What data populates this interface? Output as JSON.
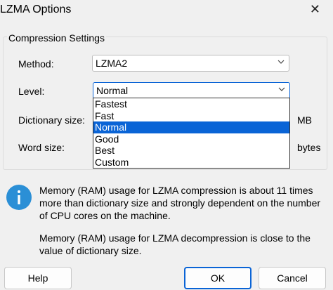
{
  "window": {
    "title": "LZMA Options",
    "close_glyph": "✕"
  },
  "group": {
    "label": "Compression Settings"
  },
  "fields": {
    "method": {
      "label": "Method:",
      "value": "LZMA2"
    },
    "level": {
      "label": "Level:",
      "value": "Normal"
    },
    "dictionary": {
      "label": "Dictionary size:",
      "unit": "MB"
    },
    "word": {
      "label": "Word size:",
      "unit": "bytes"
    }
  },
  "level_options": [
    "Fastest",
    "Fast",
    "Normal",
    "Good",
    "Best",
    "Custom"
  ],
  "level_selected_index": 2,
  "info": {
    "text1": "Memory (RAM) usage for LZMA compression is about 11 times more than dictionary size and strongly dependent on the number of CPU cores on the machine.",
    "text2": "Memory (RAM) usage for LZMA decompression is close to the value of dictionary size."
  },
  "buttons": {
    "help": "Help",
    "ok": "OK",
    "cancel": "Cancel"
  },
  "colors": {
    "accent": "#0a64d6",
    "info_icon": "#2b8fd6"
  }
}
